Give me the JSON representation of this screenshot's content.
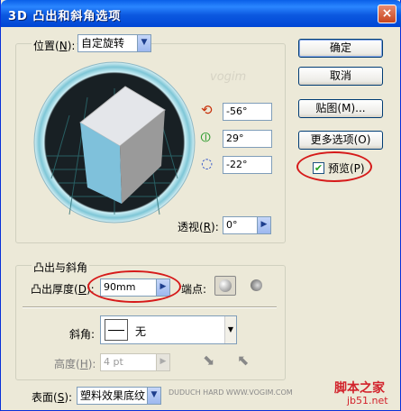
{
  "window": {
    "title": "3D 凸出和斜角选项",
    "close_glyph": "×"
  },
  "position": {
    "label": "位置",
    "hotkey": "N",
    "dropdown_value": "自定旋转",
    "rot_x": "-56°",
    "rot_y": "29°",
    "rot_z": "-22°",
    "perspective_label": "透视",
    "perspective_hotkey": "R",
    "perspective_value": "0°"
  },
  "buttons": {
    "ok": "确定",
    "cancel": "取消",
    "map": "贴图(M)...",
    "more": "更多选项(O)",
    "preview": "预览(P)"
  },
  "preview_checked": true,
  "extrude": {
    "section_title": "凸出与斜角",
    "depth_label": "凸出厚度",
    "depth_hotkey": "D",
    "depth_value": "90mm",
    "cap_label": "端点:",
    "bevel_label": "斜角:",
    "bevel_value": "无",
    "height_label": "高度",
    "height_hotkey": "H",
    "height_value": "4 pt"
  },
  "surface": {
    "label": "表面",
    "hotkey": "S",
    "value": "塑料效果底纹"
  },
  "watermarks": {
    "vogim": "vogim",
    "site": "脚本之家",
    "site_url": "jb51.net",
    "bottom": "DUDUCH HARD  WWW.VOGIM.COM"
  },
  "colors": {
    "accent_red": "#d61a1a",
    "cube_top": "#e4e6ea",
    "cube_left": "#7fc1db",
    "cube_right": "#9a9a9a",
    "ring": "#7ec6d6"
  }
}
